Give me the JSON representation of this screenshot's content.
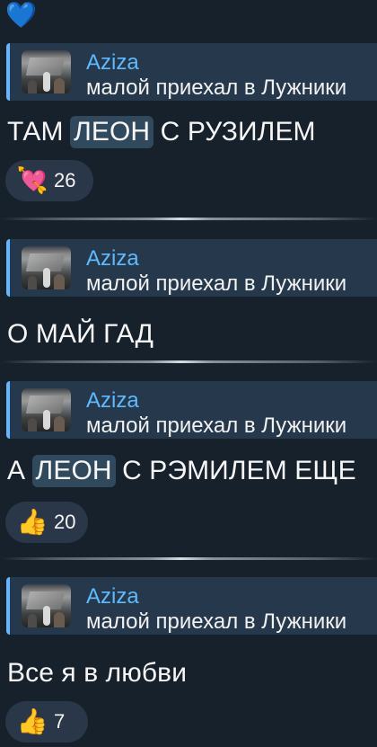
{
  "messages": [
    {
      "reply": {
        "author": "Aziza",
        "snippet": "малой приехал в Лужники"
      },
      "text_prefix": "ТАМ ",
      "highlight": "ЛЕОН",
      "text_suffix": " С РУЗИЛЕМ",
      "reaction": {
        "emoji_name": "heart-with-ribbon-icon",
        "count": "26"
      }
    },
    {
      "reply": {
        "author": "Aziza",
        "snippet": "малой приехал в Лужники"
      },
      "text": "О МАЙ ГАД"
    },
    {
      "reply": {
        "author": "Aziza",
        "snippet": "малой приехал в Лужники"
      },
      "text_prefix": "А ",
      "highlight": "ЛЕОН",
      "text_suffix": " С РЭМИЛЕМ ЕЩЕ",
      "reaction": {
        "emoji_name": "thumbs-up-icon",
        "count": "20"
      }
    },
    {
      "reply": {
        "author": "Aziza",
        "snippet": "малой приехал в Лужники"
      },
      "text": "Все я в любви",
      "reaction": {
        "emoji_name": "thumbs-up-icon",
        "count": "7"
      }
    }
  ],
  "top_reaction_icon": "blue-heart-icon"
}
